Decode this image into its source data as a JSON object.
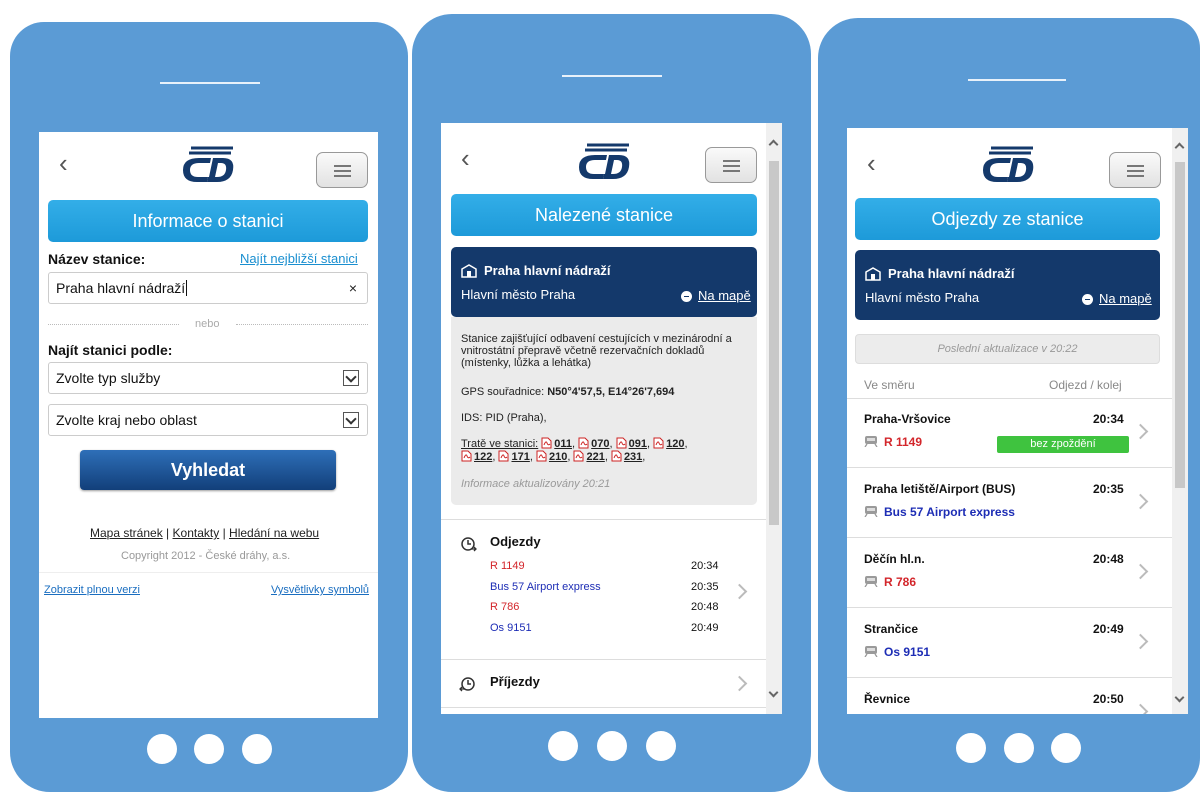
{
  "screen1": {
    "title": "Informace o stanici",
    "station_label": "Název stanice:",
    "nearest_link": "Najít nejbližší stanici",
    "station_value": "Praha hlavní nádraží",
    "clear_symbol": "×",
    "or_text": "nebo",
    "find_by_label": "Najít stanici podle:",
    "service_select": "Zvolte typ služby",
    "region_select": "Zvolte kraj nebo oblast",
    "search_button": "Vyhledat",
    "footer": {
      "sitemap": "Mapa stránek",
      "sep": "|",
      "contacts": "Kontakty",
      "web_search": "Hledání na webu"
    },
    "copyright": "Copyright 2012 - České dráhy, a.s.",
    "full_version": "Zobrazit plnou verzi",
    "symbols": "Vysvětlivky symbolů"
  },
  "screen2": {
    "title": "Nalezené stanice",
    "station": {
      "name": "Praha hlavní nádraží",
      "region": "Hlavní město Praha",
      "map_link": "Na mapě"
    },
    "info": {
      "description_line1": "Stanice zajišťující odbavení cestujících v mezinárodní a",
      "description_line2": "vnitrostátní přepravě včetně rezervačních dokladů",
      "description_line3": "(místenky, lůžka a lehátka)",
      "gps_label": "GPS souřadnice:",
      "gps_value": "N50°4'57,5, E14°26'7,694",
      "ids_label": "IDS:",
      "ids_value": "PID (Praha),",
      "tracks_label": "Tratě ve stanici:",
      "tracks_row1": [
        "011",
        "070",
        "091",
        "120"
      ],
      "tracks_row2": [
        "122",
        "171",
        "210",
        "221",
        "231"
      ],
      "updated": "Informace aktualizovány 20:21"
    },
    "departures_heading": "Odjezdy",
    "departures": [
      {
        "train": "R 1149",
        "time": "20:34",
        "color": "#d3262b"
      },
      {
        "train": "Bus 57 Airport express",
        "time": "20:35",
        "color": "#1d2db5"
      },
      {
        "train": "R 786",
        "time": "20:48",
        "color": "#d3262b"
      },
      {
        "train": "Os 9151",
        "time": "20:49",
        "color": "#1d2db5"
      }
    ],
    "arrivals_heading": "Příjezdy"
  },
  "screen3": {
    "title": "Odjezdy ze stanice",
    "station": {
      "name": "Praha hlavní nádraží",
      "region": "Hlavní město Praha",
      "map_link": "Na mapě"
    },
    "last_update": "Poslední aktualizace v 20:22",
    "col_direction": "Ve směru",
    "col_departure": "Odjezd / kolej",
    "rows": [
      {
        "dest": "Praha-Vršovice",
        "time": "20:34",
        "train": "R 1149",
        "color": "#d3262b",
        "status": "bez zpoždění"
      },
      {
        "dest": "Praha letiště/Airport (BUS)",
        "time": "20:35",
        "train": "Bus 57 Airport express",
        "color": "#1d2db5",
        "status": ""
      },
      {
        "dest": "Děčín hl.n.",
        "time": "20:48",
        "train": "R 786",
        "color": "#d3262b",
        "status": ""
      },
      {
        "dest": "Strančice",
        "time": "20:49",
        "train": "Os 9151",
        "color": "#1d2db5",
        "status": ""
      },
      {
        "dest": "Řevnice",
        "time": "20:50",
        "train": "",
        "color": "#1d2db5",
        "status": ""
      }
    ]
  },
  "colors": {
    "phone": "#5b9bd5",
    "title_bar": "#1d9ad9",
    "station_card": "#14396b",
    "search_button": "#123f7a",
    "ontime_badge": "#3fc33f"
  },
  "icons": [
    "back-arrow-icon",
    "cd-logo",
    "hamburger-menu-icon",
    "station-building-icon",
    "map-pin-icon",
    "pdf-icon",
    "departures-clock-icon",
    "arrivals-clock-icon",
    "train-icon",
    "chevron-right-icon"
  ]
}
